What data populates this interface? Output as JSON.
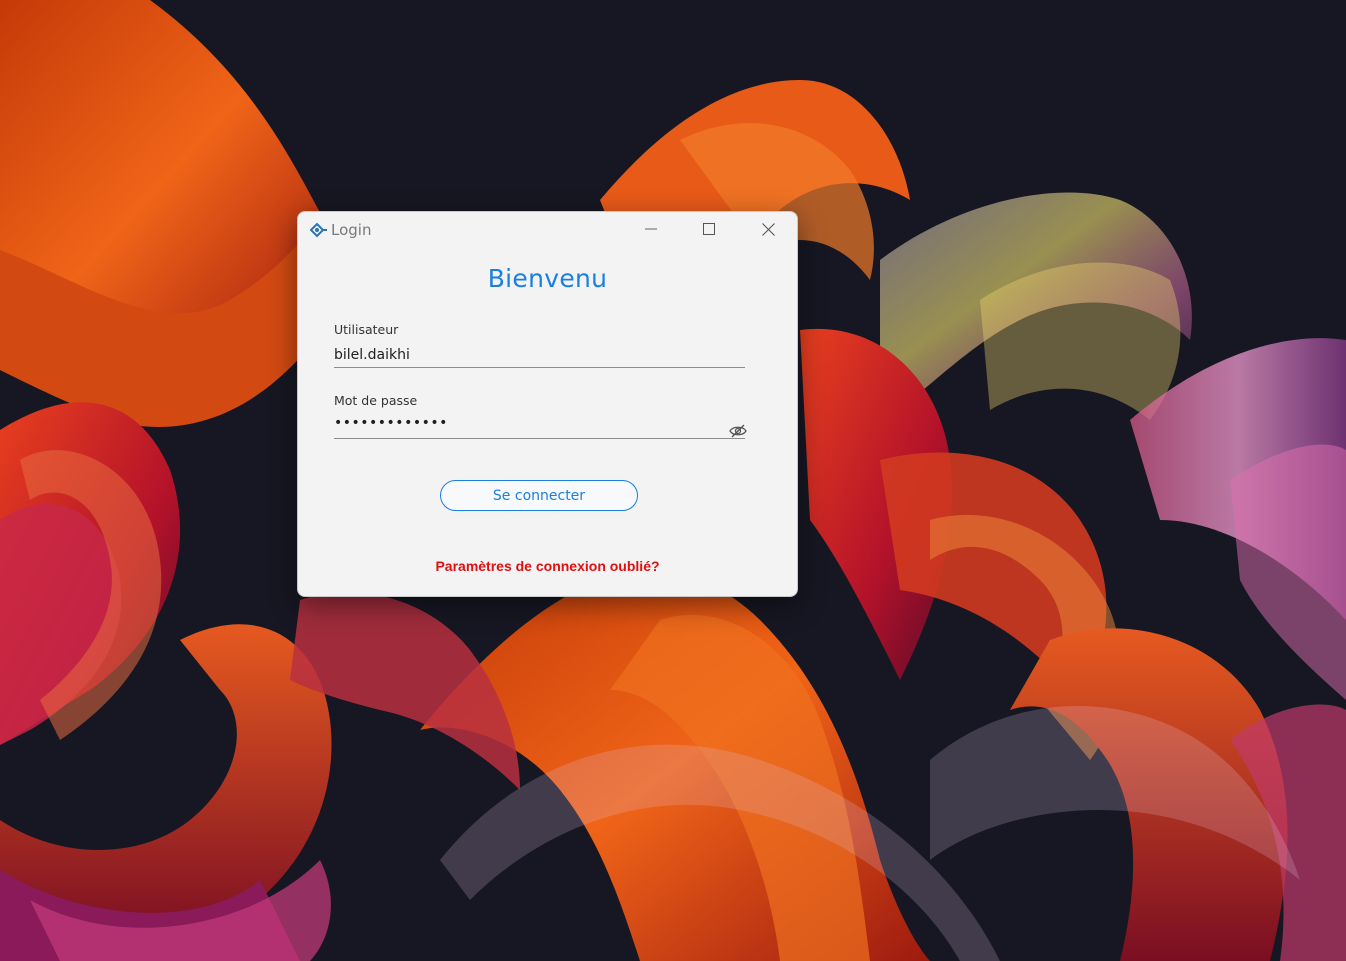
{
  "window": {
    "title": "Login",
    "controls": {
      "minimize_icon": "minimize-icon",
      "maximize_icon": "maximize-icon",
      "close_icon": "close-icon"
    }
  },
  "form": {
    "heading": "Bienvenu",
    "username": {
      "label": "Utilisateur",
      "value": "bilel.daikhi"
    },
    "password": {
      "label": "Mot de passe",
      "masked_value": "•••••••••••••",
      "reveal_icon": "eye-slash-icon"
    },
    "submit_label": "Se connecter",
    "forgot_label": "Paramètres de connexion oublié?"
  },
  "colors": {
    "accent": "#1a7fe0",
    "link": "#e01010",
    "window_bg": "#f3f3f3",
    "desktop_bg": "#161722"
  }
}
